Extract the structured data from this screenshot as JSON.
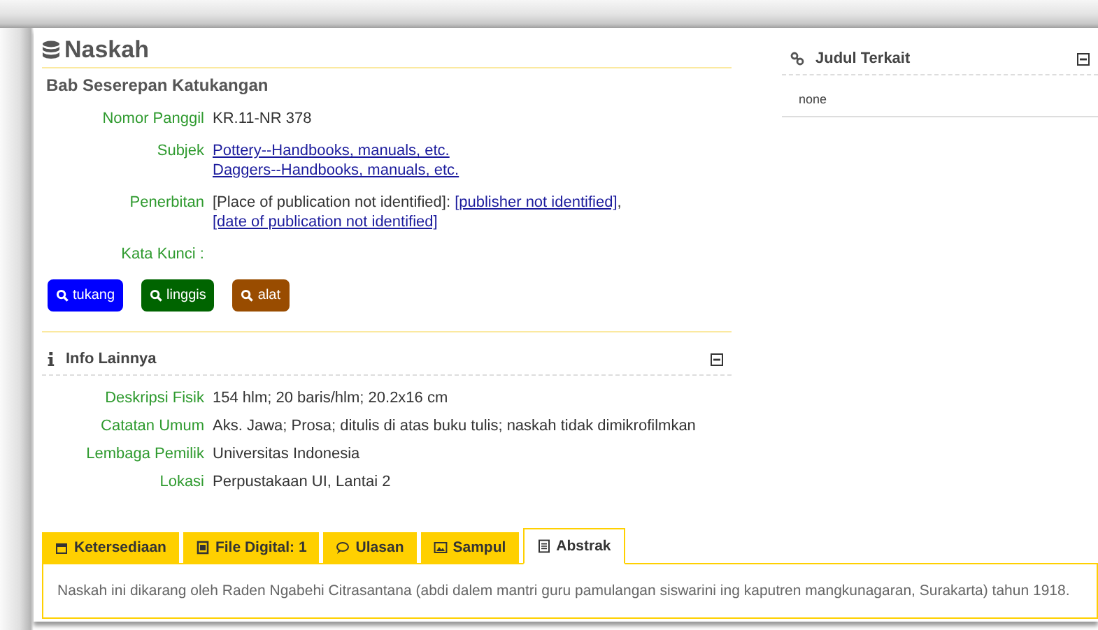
{
  "record": {
    "title": "Naskah",
    "heading": "Bab Seserepan Katukangan",
    "fields": [
      {
        "label": "Nomor Panggil",
        "lines": [
          [
            {
              "text": "KR.11-NR 378",
              "link": false
            }
          ]
        ]
      },
      {
        "label": "Subjek",
        "lines": [
          [
            {
              "text": "Pottery--Handbooks, manuals, etc.",
              "link": true
            }
          ],
          [
            {
              "text": "Daggers--Handbooks, manuals, etc.",
              "link": true
            }
          ]
        ]
      },
      {
        "label": "Penerbitan",
        "lines": [
          [
            {
              "text": "[Place of publication not identified]: ",
              "link": false
            },
            {
              "text": "[publisher not identified]",
              "link": true
            },
            {
              "text": ", ",
              "link": false
            },
            {
              "text": "[date of publication not identified]",
              "link": true
            }
          ]
        ]
      },
      {
        "label": "Kata Kunci :"
      }
    ],
    "keywords": [
      {
        "text": "tukang",
        "color": "#0000ff"
      },
      {
        "text": "linggis",
        "color": "#006400"
      },
      {
        "text": "alat",
        "color": "#994c00"
      }
    ]
  },
  "info": {
    "title": "Info Lainnya",
    "expanded": true,
    "fields": [
      {
        "label": "Deskripsi Fisik",
        "value": "154 hlm; 20 baris/hlm; 20.2x16 cm"
      },
      {
        "label": "Catatan Umum",
        "value": "Aks. Jawa; Prosa; ditulis di atas buku tulis; naskah tidak dimikrofilmkan"
      },
      {
        "label": "Lembaga Pemilik",
        "value": "Universitas Indonesia"
      },
      {
        "label": "Lokasi",
        "value": "Perpustakaan UI, Lantai 2"
      }
    ]
  },
  "related": {
    "title": "Judul Terkait",
    "expanded": true,
    "value": "none"
  },
  "tabs": [
    {
      "label": "Ketersediaan",
      "selected": false
    },
    {
      "label": "File Digital: 1",
      "selected": false
    },
    {
      "label": "Ulasan",
      "selected": false
    },
    {
      "label": "Sampul",
      "selected": false
    },
    {
      "label": "Abstrak",
      "selected": true
    }
  ],
  "tab_content": "Naskah ini dikarang oleh Raden Ngabehi Citrasantana (abdi dalem mantri guru pamulangan siswarini ing kaputren mangkunagaran, Surakarta) tahun 1918."
}
